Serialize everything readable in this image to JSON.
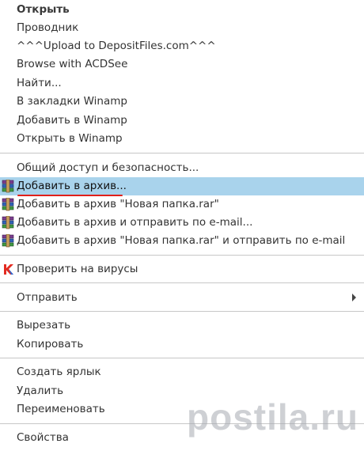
{
  "menu": {
    "group1": [
      {
        "label": "Открыть"
      },
      {
        "label": "Проводник"
      },
      {
        "label": "^^^Upload to DepositFiles.com^^^"
      },
      {
        "label": "Browse with ACDSee"
      },
      {
        "label": "Найти..."
      },
      {
        "label": "В закладки Winamp"
      },
      {
        "label": "Добавить в Winamp"
      },
      {
        "label": "Открыть в Winamp"
      }
    ],
    "sharing": {
      "label": "Общий доступ и безопасность..."
    },
    "archive": [
      {
        "label": "Добавить в архив...",
        "icon": "winrar-icon"
      },
      {
        "label": "Добавить в архив \"Новая папка.rar\"",
        "icon": "winrar-icon"
      },
      {
        "label": "Добавить в архив и отправить по e-mail...",
        "icon": "winrar-icon"
      },
      {
        "label": "Добавить в архив \"Новая папка.rar\" и отправить по e-mail",
        "icon": "winrar-icon"
      }
    ],
    "virus": {
      "label": "Проверить на вирусы",
      "icon": "kaspersky-icon"
    },
    "send": {
      "label": "Отправить",
      "icon": "submenu-arrow-icon"
    },
    "clipboard": [
      {
        "label": "Вырезать"
      },
      {
        "label": "Копировать"
      }
    ],
    "file_ops": [
      {
        "label": "Создать ярлык"
      },
      {
        "label": "Удалить"
      },
      {
        "label": "Переименовать"
      }
    ],
    "properties": {
      "label": "Свойства"
    }
  },
  "colors": {
    "highlight": "#a9d3ec",
    "underline": "#e0201b",
    "separator": "#c7c7c7"
  },
  "watermark": {
    "text": "postila.ru"
  }
}
